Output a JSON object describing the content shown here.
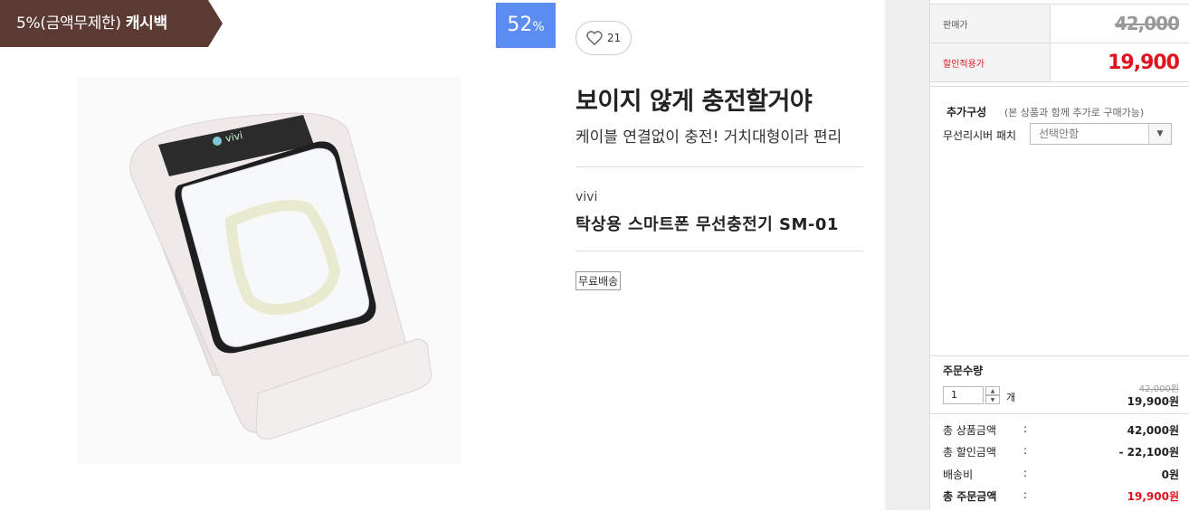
{
  "left": {
    "cashback": {
      "prefix": "5%(금액무제한) ",
      "bold": "캐시백"
    },
    "discount": {
      "value": "52",
      "unit": "%"
    },
    "like": {
      "count": "21"
    },
    "title": "보이지 않게 충전할거야",
    "subtitle": "케이블 연결없이 충전! 거치대형이라 편리",
    "brand": "vivi",
    "product_name": "탁상용 스마트폰 무선충전기 SM-01",
    "shipping_badge": "무료배송",
    "image_logo": "vivi"
  },
  "right": {
    "price": [
      {
        "label": "판매가",
        "value": "42,000"
      },
      {
        "label": "할인적용가",
        "value": "19,900"
      }
    ],
    "option": {
      "title": "추가구성",
      "note": "(본 상품과 함께 추가로 구매가능)",
      "label": "무선리시버 패치",
      "selected": "선택안함"
    },
    "quantity": {
      "title": "주문수량",
      "value": "1",
      "unit": "개",
      "original": "42,000원",
      "price": "19,900원"
    },
    "summary": [
      {
        "label": "총 상품금액",
        "colon": ":",
        "value": "42,000원"
      },
      {
        "label": "총 할인금액",
        "colon": ":",
        "value": "- 22,100원"
      },
      {
        "label": "배송비",
        "colon": ":",
        "value": "0원"
      },
      {
        "label": "총 주문금액",
        "colon": ":",
        "value": "19,900원"
      }
    ]
  },
  "colors": {
    "ribbon": "#5b3a33",
    "discount": "#5b8df0",
    "accent_red": "#e0141e"
  }
}
